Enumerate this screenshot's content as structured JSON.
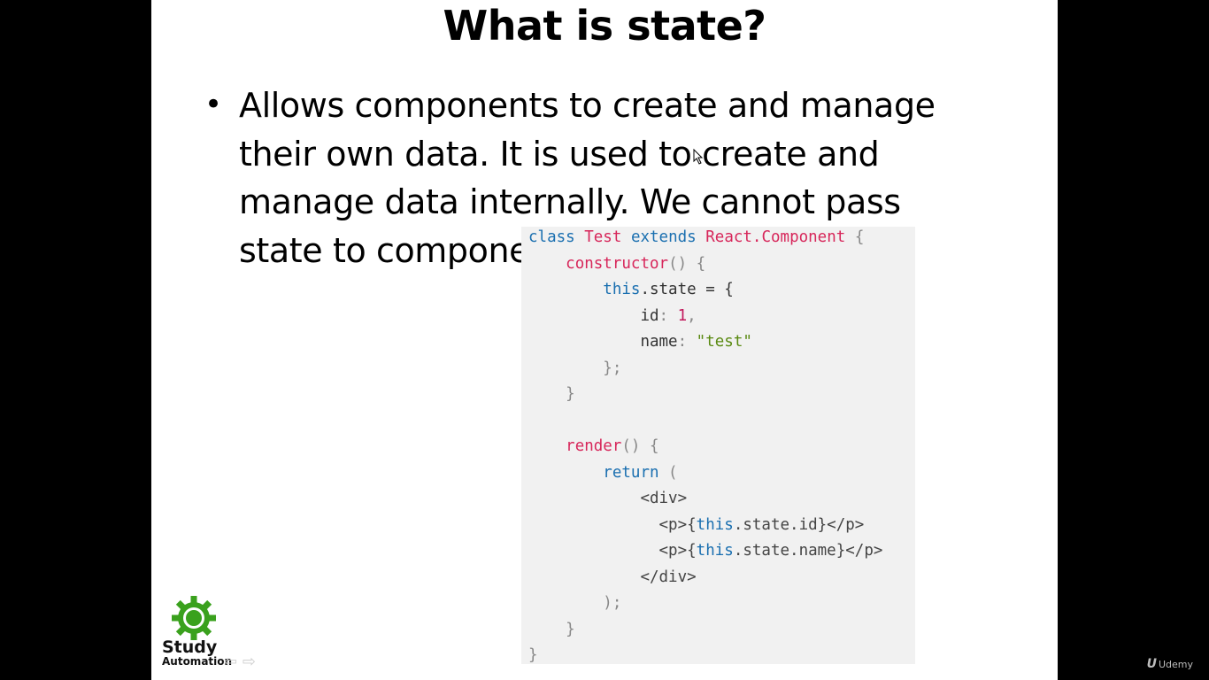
{
  "slide": {
    "title": "What is state?",
    "bullet_marker": "•",
    "bullet_text": "Allows components to create and manage their own data. It is used to create and manage data internally. We cannot pass state to component."
  },
  "code_lines": [
    [
      "class",
      " ",
      "Test",
      " ",
      "extends",
      " ",
      "React.Component",
      " {"
    ],
    [
      "constructor",
      "() {"
    ],
    [
      "this",
      ".state = {"
    ],
    [
      "id",
      ": ",
      "1",
      ","
    ],
    [
      "name",
      ": ",
      "\"test\""
    ],
    [
      "};"
    ],
    [
      "}"
    ],
    [
      "render",
      "() {"
    ],
    [
      "return",
      " ("
    ],
    [
      "<div>"
    ],
    [
      "<p>{",
      "this",
      ".state.id}</p>"
    ],
    [
      "<p>{",
      "this",
      ".state.name}</p>"
    ],
    [
      "</div>"
    ],
    [
      ");"
    ],
    [
      "}"
    ],
    [
      "}"
    ]
  ],
  "branding": {
    "logo_line1": "Study",
    "logo_line2": "Automation",
    "watermark": "Udemy",
    "watermark_glyph": "U"
  },
  "colors": {
    "keyword": "#1a6fb0",
    "class_name": "#d7265a",
    "number": "#c2185b",
    "string": "#5a8a12",
    "logo_green": "#3aa11d"
  }
}
